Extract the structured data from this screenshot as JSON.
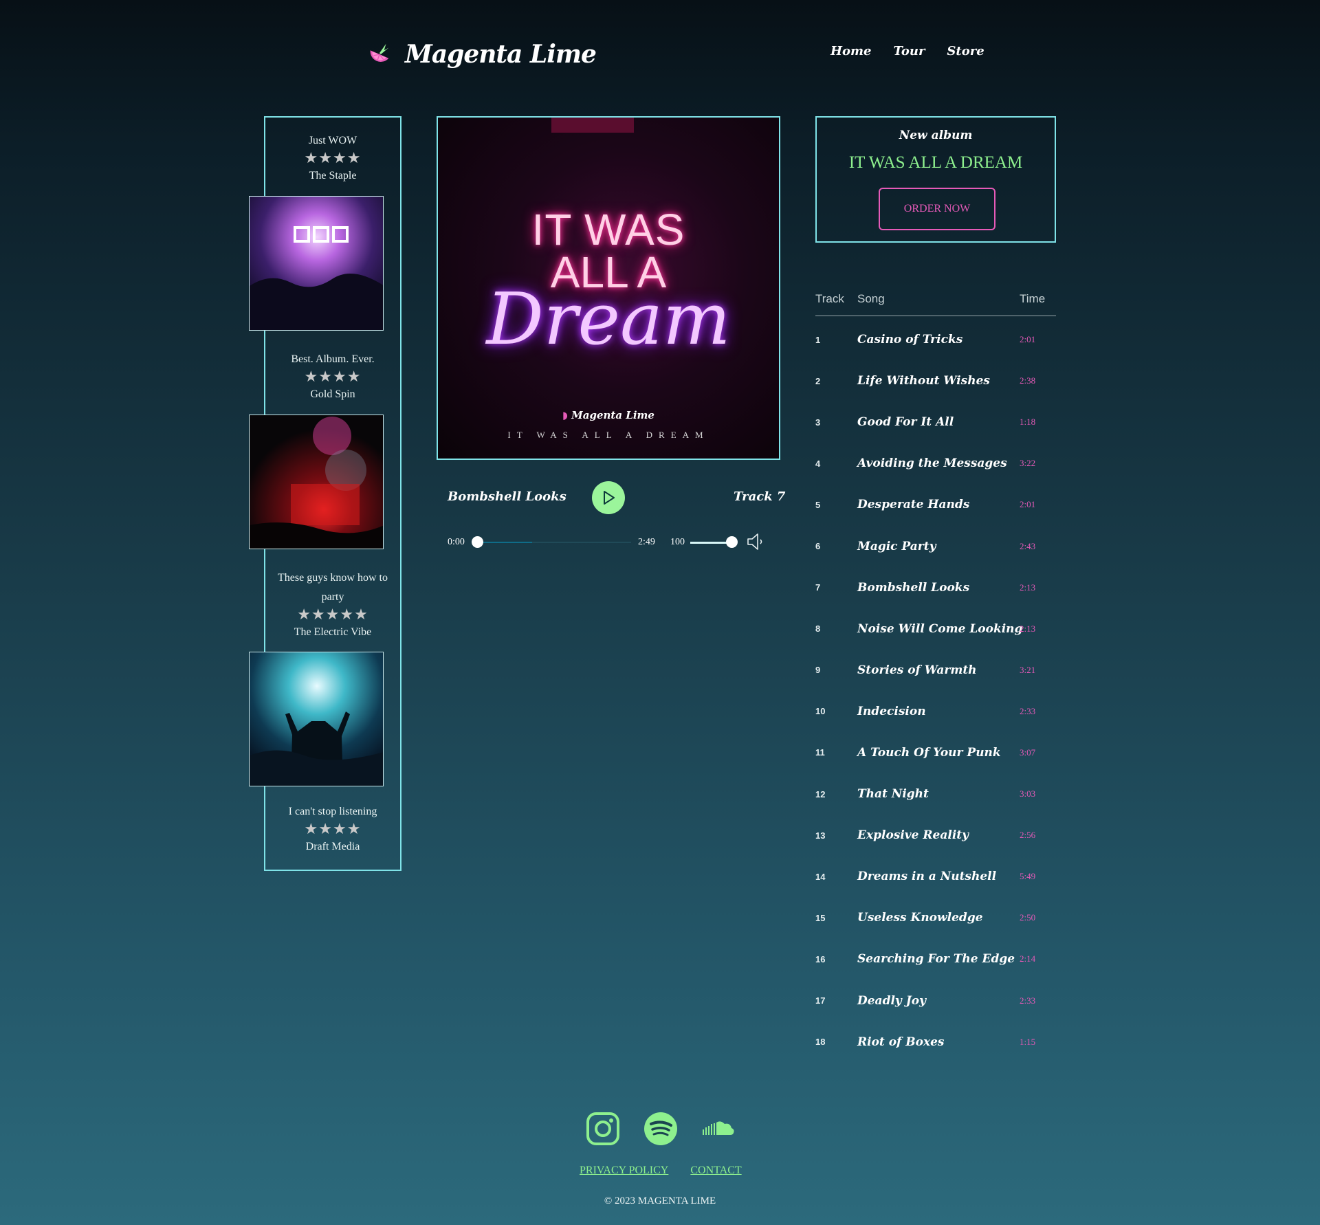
{
  "header": {
    "brand": "Magenta Lime",
    "nav": [
      "Home",
      "Tour",
      "Store"
    ]
  },
  "reviews": [
    {
      "quote": "Just WOW",
      "stars": 4,
      "source": "The Staple"
    },
    {
      "quote": "Best. Album. Ever.",
      "stars": 4,
      "source": "Gold Spin"
    },
    {
      "quote": "These guys know how to party",
      "stars": 5,
      "source": "The Electric Vibe"
    },
    {
      "quote": "I can't stop listening",
      "stars": 4,
      "source": "Draft Media"
    }
  ],
  "cover": {
    "neon_line1": "IT WAS",
    "neon_line2": "ALL A",
    "neon_line3": "Dream",
    "brand": "Magenta Lime",
    "title": "IT WAS ALL A DREAM"
  },
  "player": {
    "song": "Bombshell Looks",
    "track": "Track 7",
    "time_current": "0:00",
    "time_total": "2:49",
    "progress": 0.0,
    "volume": "100",
    "volume_level": 1.0
  },
  "new_album": {
    "label": "New album",
    "title": "IT WAS ALL A DREAM",
    "order_label": "ORDER NOW"
  },
  "tracklist": {
    "headers": {
      "track": "Track",
      "song": "Song",
      "time": "Time"
    },
    "tracks": [
      {
        "num": "1",
        "song": "Casino of Tricks",
        "time": "2:01"
      },
      {
        "num": "2",
        "song": "Life Without Wishes",
        "time": "2:38"
      },
      {
        "num": "3",
        "song": "Good For It All",
        "time": "1:18"
      },
      {
        "num": "4",
        "song": "Avoiding the Messages",
        "time": "3:22"
      },
      {
        "num": "5",
        "song": "Desperate Hands",
        "time": "2:01"
      },
      {
        "num": "6",
        "song": "Magic Party",
        "time": "2:43"
      },
      {
        "num": "7",
        "song": "Bombshell Looks",
        "time": "2:13"
      },
      {
        "num": "8",
        "song": "Noise Will Come Looking",
        "time": "2:13"
      },
      {
        "num": "9",
        "song": "Stories of Warmth",
        "time": "3:21"
      },
      {
        "num": "10",
        "song": "Indecision",
        "time": "2:33"
      },
      {
        "num": "11",
        "song": "A Touch Of Your Punk",
        "time": "3:07"
      },
      {
        "num": "12",
        "song": "That Night",
        "time": "3:03"
      },
      {
        "num": "13",
        "song": "Explosive Reality",
        "time": "2:56"
      },
      {
        "num": "14",
        "song": "Dreams in a Nutshell",
        "time": "5:49"
      },
      {
        "num": "15",
        "song": "Useless Knowledge",
        "time": "2:50"
      },
      {
        "num": "16",
        "song": "Searching For The Edge",
        "time": "2:14"
      },
      {
        "num": "17",
        "song": "Deadly Joy",
        "time": "2:33"
      },
      {
        "num": "18",
        "song": "Riot of Boxes",
        "time": "1:15"
      }
    ]
  },
  "footer": {
    "socials": [
      "instagram-icon",
      "spotify-icon",
      "soundcloud-icon"
    ],
    "privacy": "PRIVACY POLICY",
    "contact": "CONTACT",
    "copyright": "© 2023 MAGENTA LIME"
  },
  "colors": {
    "accent_cyan": "#7fe3e8",
    "accent_green": "#8ef08e",
    "accent_magenta": "#e65ab8"
  }
}
